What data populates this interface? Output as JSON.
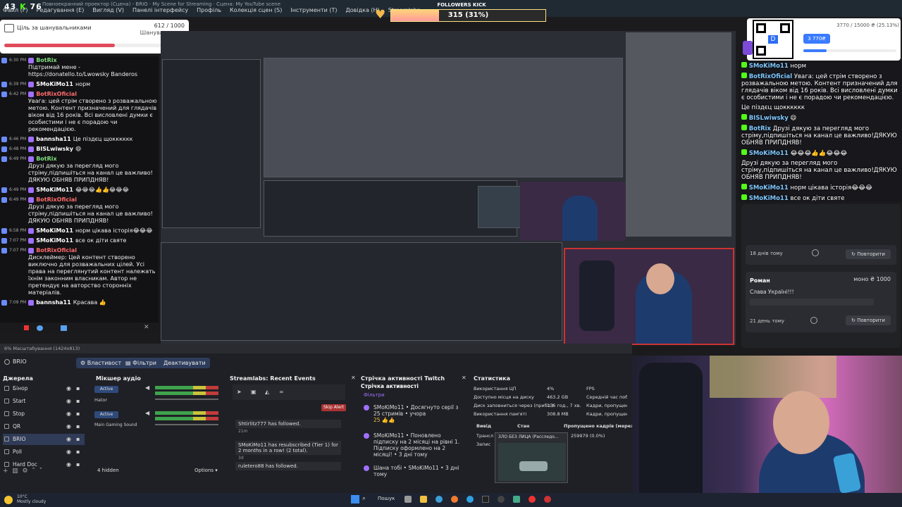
{
  "top_counter": {
    "value_a": "43",
    "value_b": "76"
  },
  "menu": {
    "title": "Повноекранний проектор (Сцена) - BRIO · My Scene for Streaming · Сцена: My YouTube scene",
    "items": [
      "Файл (F)",
      "Редагування (E)",
      "Вигляд (V)",
      "Панелі інтерфейсу",
      "Профіль",
      "Колекція сцен (S)",
      "Інструменти (T)",
      "Довідка (H)",
      "Streamlabs"
    ]
  },
  "followers": {
    "label": "FOLLOWERS KICK",
    "text": "315 (31%)",
    "progress": 0.31
  },
  "goal_left": {
    "title": "Ціль за шанувальниками",
    "count": "612 / 1000",
    "subtitle": "Шанувальники",
    "progress": 0.612
  },
  "chat_left": [
    {
      "time": "6:30 PM",
      "nick": "BotRix",
      "color": "#7fe07f",
      "text": "Підтримай мене - https://donatello.to/Lwowsky Banderos"
    },
    {
      "time": "6:39 PM",
      "nick": "SMoKiMo11",
      "color": "#ffffff",
      "text": "норм"
    },
    {
      "time": "6:42 PM",
      "nick": "BotRixOficial",
      "color": "#ff6b6b",
      "text": "Увага: цей стрім створено з розважальною метою. Контент призначений для глядачів віком від 16 років. Всі висловлені думки є особистими і не є порадою чи рекомендацією."
    },
    {
      "time": "6:46 PM",
      "nick": "bannsha11",
      "color": "#ffffff",
      "text": "Це піздєц щокккккк"
    },
    {
      "time": "6:48 PM",
      "nick": "BISLwiwsky",
      "color": "#ffffff",
      "text": "😄"
    },
    {
      "time": "6:49 PM",
      "nick": "BotRix",
      "color": "#7fe07f",
      "text": "Друзі дякую за перегляд мого стріму,підпишіться на канал це важливо!ДЯКУЮ ОБНЯВ ПРИПДНЯВ!"
    },
    {
      "time": "6:49 PM",
      "nick": "SMoKiMo11",
      "color": "#ffffff",
      "text": "😂😂😂👍👍😂😂😂"
    },
    {
      "time": "6:49 PM",
      "nick": "BotRixOficial",
      "color": "#ff6b6b",
      "text": "Друзі дякую за перегляд мого стріму,підпишіться на канал це важливо!ДЯКУЮ ОБНЯВ ПРИПДНЯВ!"
    },
    {
      "time": "6:58 PM",
      "nick": "SMoKiMo11",
      "color": "#ffffff",
      "text": "норм цікава історія😂😂😂"
    },
    {
      "time": "7:07 PM",
      "nick": "SMoKiMo11",
      "color": "#ffffff",
      "text": "все ок діти святе"
    },
    {
      "time": "7:07 PM",
      "nick": "BotRixOficial",
      "color": "#ff6b6b",
      "text": "Дисклеймер: Цей контент створено виключно для розважальних цілей. Усі права на переглянутий контент належать їхнім законним власникам. Автор не претендує на авторство сторонніх матеріалів."
    },
    {
      "time": "7:09 PM",
      "nick": "bannsha11",
      "color": "#ffffff",
      "text": "Красава 👍"
    }
  ],
  "goal_right": {
    "count": "3770 / 15000 ₴ (25.13%)",
    "amount": "3 770₴",
    "progress": 0.2513
  },
  "chat_right": [
    {
      "nick": "SMoKiMo11",
      "text": "норм"
    },
    {
      "nick": "BotRixOficial",
      "text": "Увага: цей стрім створено з розважальною метою. Контент призначений для глядачів віком від 16 років. Всі висловлені думки є особистими і не є порадою чи рекомендацією."
    },
    {
      "nick": "",
      "text": "Це піздєц щокккккк"
    },
    {
      "nick": "BISLwiwsky",
      "text": "😄"
    },
    {
      "nick": "BotRix",
      "text": "Друзі дякую за перегляд мого стріму,підпишіться на канал це важливо!ДЯКУЮ ОБНЯВ ПРИПДНЯВ!"
    },
    {
      "nick": "SMoKiMo11",
      "text": "😂😂😂👍👍😂😂😂"
    },
    {
      "nick": "",
      "text": "Друзі дякую за перегляд мого стріму,підпишіться на канал це важливо!ДЯКУЮ ОБНЯВ ПРИПДНЯВ!"
    },
    {
      "nick": "SMoKiMo11",
      "text": "норм цікава історія😂😂😂"
    },
    {
      "nick": "SMoKiMo11",
      "text": "все ок діти святе"
    },
    {
      "nick": "",
      "text": "Дисклеймер: Цей контент створено виключно для розважальних цілей. Усі права на переглянутий контент належать їхнім законним власникам. Автор не претендує на авторство сторонніх матеріалів."
    },
    {
      "nick": "",
      "text": "Красава 👍"
    }
  ],
  "donations": [
    {
      "name": "",
      "amount": "",
      "message": "",
      "ago": "18 днів тому",
      "button": "Повторити"
    },
    {
      "name": "Роман",
      "amount": "моно ₴ 1000",
      "message": "Слава Україні!!!",
      "ago": "21 день тому",
      "button": "Повторити"
    }
  ],
  "obs": {
    "status": "6%     Масштабування (1424x813)",
    "active_scene": "BRIO",
    "buttons": {
      "props": "Властивості",
      "filters": "Фільтри",
      "deactivate": "Деактивувати"
    },
    "docks": {
      "sources": "Джерела",
      "mixer": "Мікшер аудіо",
      "events": "Streamlabs: Recent Events",
      "activity": "Стрічка активності Twitch",
      "stats": "Статистика"
    },
    "sources": [
      "Бінор",
      "Start",
      "Stop",
      "QR",
      "BRIO",
      "Poll",
      "Hard Doc"
    ],
    "hidden": "4 hidden",
    "options": "Options",
    "mixer": [
      {
        "label": "Active",
        "name": "Hator"
      },
      {
        "label": "Active",
        "name": "Main Gaming Sound"
      }
    ],
    "events": [
      {
        "text": "Shtirlitz777 has followed.",
        "ago": "21m"
      },
      {
        "text": "SMoKiMo11 has resubscribed (Tier 1) for 2 months in a row! (2 total).",
        "ago": "3d"
      },
      {
        "text": "ruletero88 has followed.",
        "ago": ""
      }
    ],
    "skip_alert": "Skip Alert",
    "activity_title": "Стрічка активності",
    "activity_filter": "Фільтри",
    "activity": [
      {
        "text": "SMoKiMo11 • Досягнуто серії з 25 стримів • учора",
        "extra": "25 👍👍"
      },
      {
        "text": "SMoKiMo11 • Поновлено підписку на 2 місяці на рівні 1. Підписку оформлено на 2 місяці! • 3 дні тому"
      },
      {
        "text": "Шана тобі • SMoKiMo11 • 3 дні тому"
      }
    ],
    "stats": [
      {
        "label": "Використання ЦП",
        "value": "4%",
        "extra": "FPS"
      },
      {
        "label": "Доступно місця на диску",
        "value": "463.2 GB",
        "extra": "Середній час побудо"
      },
      {
        "label": "Диск заповниться через (прибл.)",
        "value": "136 год., 7 хв.",
        "extra": "Кадри, пропущені че"
      },
      {
        "label": "Використання пам'яті",
        "value": "308.8 MB",
        "extra": "Кадри, пропущені че"
      }
    ],
    "stats_headers": [
      "Вивід",
      "Стан",
      "Пропущено кадрів (мережа)"
    ],
    "stats_rows": [
      "Трансл",
      "Запис"
    ],
    "dropped": "259979 (0.0%)",
    "popup_title": "ЗЛО БЕЗ ЛИЦА (Расследо..."
  },
  "taskbar": {
    "temp": "10°C",
    "weather": "Mostly cloudy",
    "search": "Пошук"
  }
}
